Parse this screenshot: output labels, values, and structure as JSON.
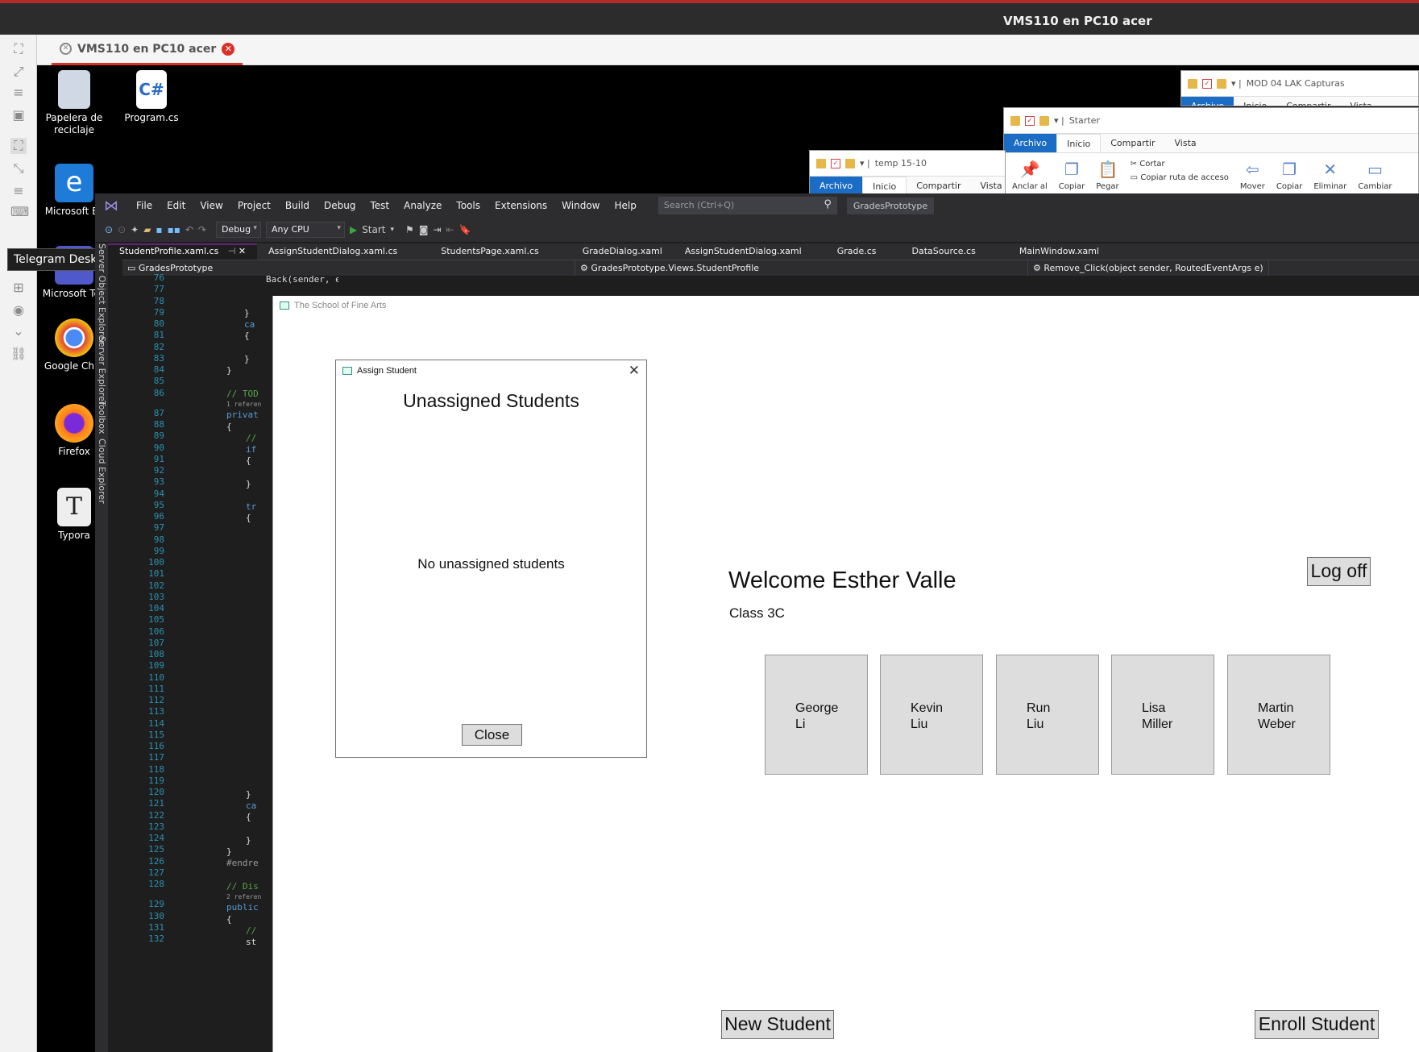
{
  "window": {
    "title": "VMS110 en PC10 acer",
    "tab_label": "VMS110 en PC10 acer"
  },
  "tooltip": "Telegram Desktop",
  "desktop_icons": [
    {
      "label": "Papelera de reciclaje"
    },
    {
      "label": "Program.cs"
    },
    {
      "label": "Microsoft Ec"
    },
    {
      "label": "Microsoft Tea"
    },
    {
      "label": "Google Chro"
    },
    {
      "label": "Firefox"
    },
    {
      "label": "Typora"
    }
  ],
  "explorers": [
    {
      "path": "MOD 04 LAK Capturas",
      "tabs": [
        "Archivo",
        "Inicio",
        "Compartir",
        "Vista"
      ]
    },
    {
      "path": "Starter",
      "tabs": [
        "Archivo",
        "Inicio",
        "Compartir",
        "Vista"
      ],
      "tools": [
        "Anclar al",
        "Copiar",
        "Pegar",
        "Cortar",
        "Copiar ruta de acceso",
        "Mover",
        "Copiar",
        "Eliminar",
        "Cambiar"
      ]
    },
    {
      "path": "temp 15-10",
      "tabs": [
        "Archivo",
        "Inicio",
        "Compartir",
        "Vista"
      ]
    }
  ],
  "vs": {
    "menu": [
      "File",
      "Edit",
      "View",
      "Project",
      "Build",
      "Debug",
      "Test",
      "Analyze",
      "Tools",
      "Extensions",
      "Window",
      "Help"
    ],
    "search_placeholder": "Search (Ctrl+Q)",
    "project_name": "GradesPrototype",
    "config": "Debug",
    "platform": "Any CPU",
    "start": "Start",
    "tabs": [
      "StudentProfile.xaml.cs",
      "AssignStudentDialog.xaml.cs",
      "StudentsPage.xaml.cs",
      "GradeDialog.xaml",
      "AssignStudentDialog.xaml",
      "Grade.cs",
      "DataSource.cs",
      "MainWindow.xaml"
    ],
    "nav": [
      "GradesPrototype",
      "GradesPrototype.Views.StudentProfile",
      "Remove_Click(object sender, RoutedEventArgs e)"
    ],
    "side_tabs": [
      "Server Object Explorer",
      "Server Explorer",
      "Toolbox",
      "Cloud Explorer"
    ],
    "line_numbers": [
      "76",
      "77",
      "78",
      "79",
      "80",
      "81",
      "82",
      "83",
      "84",
      "85",
      "86",
      "87",
      "88",
      "89",
      "90",
      "91",
      "92",
      "93",
      "94",
      "95",
      "96",
      "97",
      "98",
      "99",
      "100",
      "101",
      "102",
      "103",
      "104",
      "105",
      "106",
      "107",
      "108",
      "109",
      "110",
      "111",
      "112",
      "113",
      "114",
      "115",
      "116",
      "117",
      "118",
      "119",
      "120",
      "121",
      "122",
      "123",
      "124",
      "125",
      "126",
      "127",
      "128",
      "129",
      "130",
      "131",
      "132"
    ],
    "code_fragments": {
      "l76": "Back(sender, e);",
      "l79": "}",
      "l80": "ca",
      "l81": "{",
      "l83": "}",
      "l84": "}",
      "l86": "// TOD",
      "ref1": "1 referen",
      "l87": "privat",
      "l88": "{",
      "l89": "//",
      "l90": "if",
      "l91": "{",
      "l93": "}",
      "l95": "tr",
      "l96": "{",
      "l120": "}",
      "l121": "ca",
      "l122": "{",
      "l124": "}",
      "l125": "}",
      "l126": "#endre",
      "l128": "// Dis",
      "ref2": "2 referen",
      "l129": "public",
      "l130": "{",
      "l131": "//",
      "l132": "st"
    }
  },
  "app": {
    "title": "The School of Fine Arts",
    "welcome": "Welcome Esther Valle",
    "class": "Class 3C",
    "logoff": "Log off",
    "students": [
      {
        "first": "George",
        "last": "Li"
      },
      {
        "first": "Kevin",
        "last": "Liu"
      },
      {
        "first": "Run",
        "last": "Liu"
      },
      {
        "first": "Lisa",
        "last": "Miller"
      },
      {
        "first": "Martin",
        "last": "Weber"
      }
    ],
    "new_student": "New Student",
    "enroll_student": "Enroll Student"
  },
  "dialog": {
    "title": "Assign Student",
    "heading": "Unassigned Students",
    "empty_message": "No unassigned students",
    "close": "Close"
  }
}
